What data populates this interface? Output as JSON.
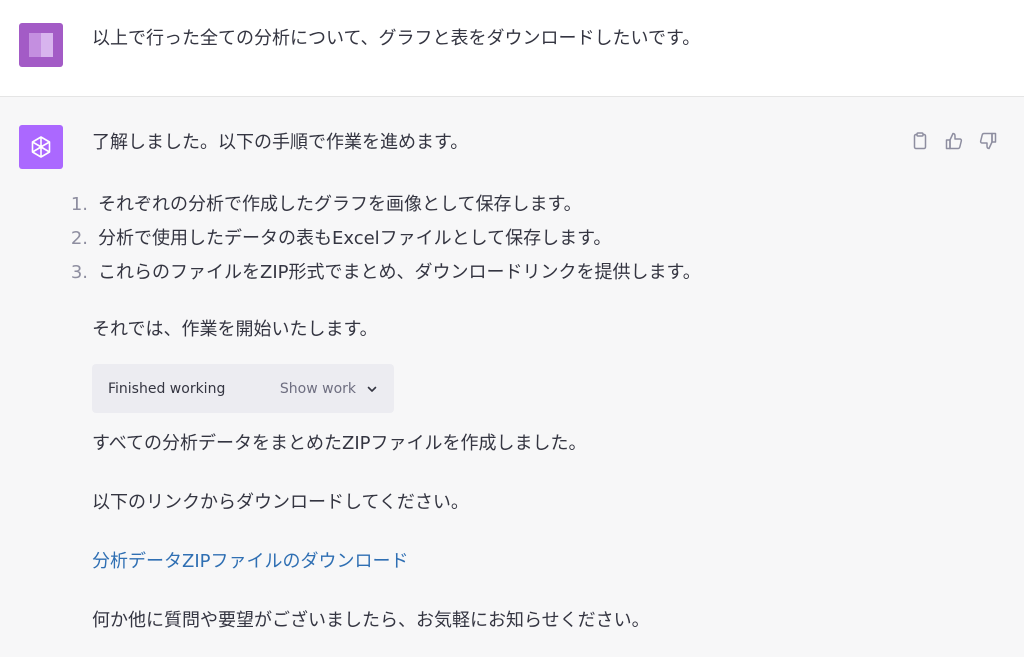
{
  "user_message": {
    "text": "以上で行った全ての分析について、グラフと表をダウンロードしたいです。"
  },
  "assistant_message": {
    "intro": "了解しました。以下の手順で作業を進めます。",
    "steps": [
      {
        "num": "1.",
        "text": "それぞれの分析で作成したグラフを画像として保存します。"
      },
      {
        "num": "2.",
        "text": "分析で使用したデータの表もExcelファイルとして保存します。"
      },
      {
        "num": "3.",
        "text": "これらのファイルをZIP形式でまとめ、ダウンロードリンクを提供します。"
      }
    ],
    "start_text": "それでは、作業を開始いたします。",
    "work_box": {
      "status": "Finished working",
      "toggle_label": "Show work"
    },
    "done_text": "すべての分析データをまとめたZIPファイルを作成しました。",
    "link_intro": "以下のリンクからダウンロードしてください。",
    "download_link": "分析データZIPファイルのダウンロード",
    "closing": "何か他に質問や要望がございましたら、お気軽にお知らせください。"
  },
  "icons": {
    "copy": "clipboard-icon",
    "like": "thumbs-up-icon",
    "dislike": "thumbs-down-icon",
    "assistant_logo": "openai-logo-icon",
    "toggle": "chevron-down-icon"
  },
  "colors": {
    "assistant_avatar": "#ab68ff",
    "user_avatar": "#a35bc6",
    "link": "#2f6fb3",
    "assistant_bg": "#f7f7f8",
    "user_bg": "#ffffff"
  }
}
